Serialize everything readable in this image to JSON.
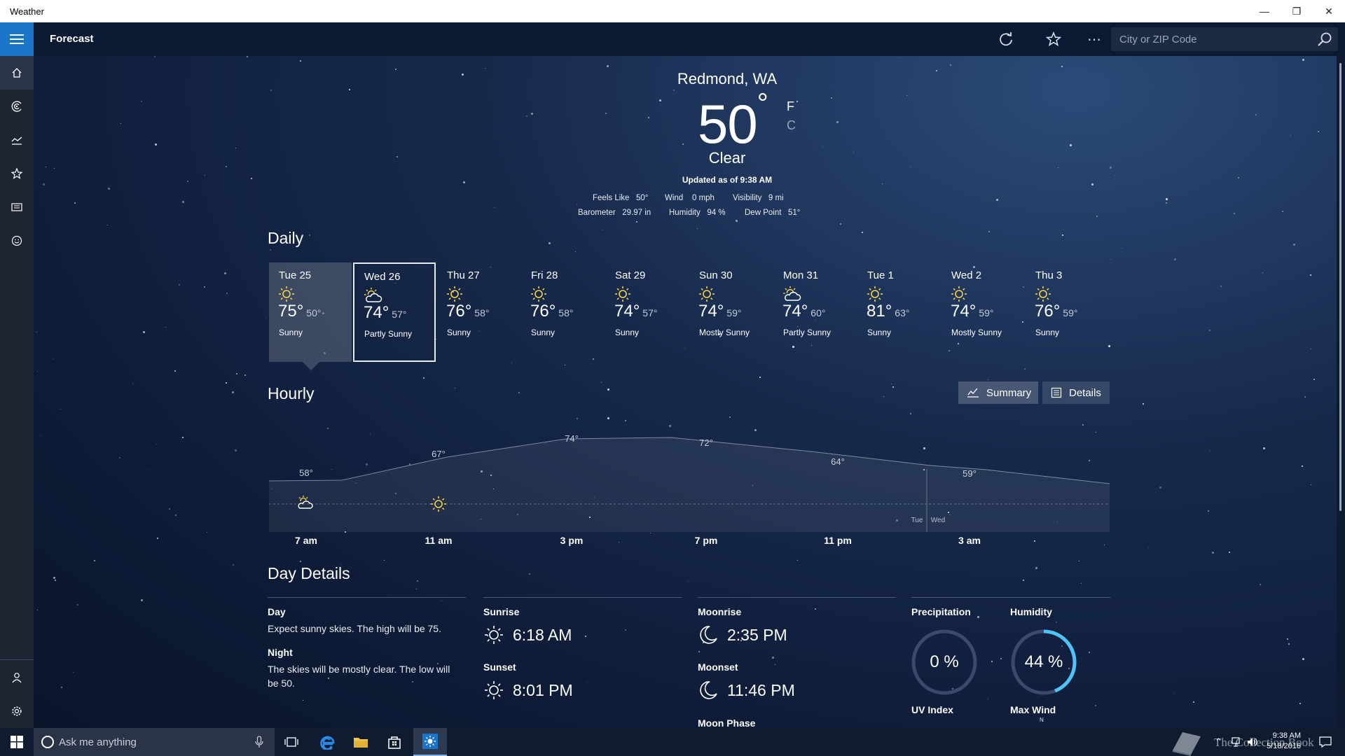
{
  "window": {
    "title": "Weather"
  },
  "header": {
    "title": "Forecast",
    "search_placeholder": "City or ZIP Code"
  },
  "current": {
    "location": "Redmond, WA",
    "temperature": "50",
    "degree": "°",
    "unit_f": "F",
    "unit_c": "C",
    "condition": "Clear",
    "updated": "Updated as of 9:38 AM",
    "observations": [
      {
        "label": "Feels Like",
        "value": "50°"
      },
      {
        "label": "Wind",
        "value": "0 mph"
      },
      {
        "label": "Visibility",
        "value": "9 mi"
      },
      {
        "label": "Barometer",
        "value": "29.97 in"
      },
      {
        "label": "Humidity",
        "value": "94 %"
      },
      {
        "label": "Dew Point",
        "value": "51°"
      }
    ]
  },
  "daily": {
    "title": "Daily",
    "days": [
      {
        "name": "Tue 25",
        "high": "75°",
        "low": "50°",
        "condition": "Sunny",
        "icon": "sun-icon"
      },
      {
        "name": "Wed 26",
        "high": "74°",
        "low": "57°",
        "condition": "Partly Sunny",
        "icon": "partly-sunny-icon"
      },
      {
        "name": "Thu 27",
        "high": "76°",
        "low": "58°",
        "condition": "Sunny",
        "icon": "sun-icon"
      },
      {
        "name": "Fri 28",
        "high": "76°",
        "low": "58°",
        "condition": "Sunny",
        "icon": "sun-icon"
      },
      {
        "name": "Sat 29",
        "high": "74°",
        "low": "57°",
        "condition": "Sunny",
        "icon": "sun-icon"
      },
      {
        "name": "Sun 30",
        "high": "74°",
        "low": "59°",
        "condition": "Mostly Sunny",
        "icon": "sun-icon"
      },
      {
        "name": "Mon 31",
        "high": "74°",
        "low": "60°",
        "condition": "Partly Sunny",
        "icon": "partly-sunny-icon"
      },
      {
        "name": "Tue 1",
        "high": "81°",
        "low": "63°",
        "condition": "Sunny",
        "icon": "sun-icon"
      },
      {
        "name": "Wed 2",
        "high": "74°",
        "low": "59°",
        "condition": "Mostly Sunny",
        "icon": "sun-icon"
      },
      {
        "name": "Thu 3",
        "high": "76°",
        "low": "59°",
        "condition": "Sunny",
        "icon": "sun-icon"
      }
    ]
  },
  "hourly": {
    "title": "Hourly",
    "summary_label": "Summary",
    "details_label": "Details",
    "temps": [
      {
        "label": "58°"
      },
      {
        "label": "67°"
      },
      {
        "label": "74°"
      },
      {
        "label": "72°"
      },
      {
        "label": "64°"
      },
      {
        "label": "59°"
      }
    ],
    "times": [
      "7 am",
      "11 am",
      "3 pm",
      "7 pm",
      "11 pm",
      "3 am"
    ],
    "day_markers": [
      "Tue",
      "Wed"
    ]
  },
  "day_details": {
    "title": "Day Details",
    "day_label": "Day",
    "day_text": "Expect sunny skies. The high will be 75.",
    "night_label": "Night",
    "night_text_1": "The skies will be mostly clear. The low will",
    "night_text_2": "be 50.",
    "sunrise_label": "Sunrise",
    "sunrise": "6:18 AM",
    "sunset_label": "Sunset",
    "sunset": "8:01 PM",
    "moonrise_label": "Moonrise",
    "moonrise": "2:35 PM",
    "moonset_label": "Moonset",
    "moonset": "11:46 PM",
    "moon_phase_label": "Moon Phase",
    "precip_label": "Precipitation",
    "precip": "0 %",
    "precip_fraction": 0,
    "humidity_label": "Humidity",
    "humidity": "44 %",
    "humidity_fraction": 0.44,
    "uv_label": "UV Index",
    "wind_label": "Max Wind",
    "wind_dir": "N"
  },
  "taskbar": {
    "cortana_placeholder": "Ask me anything",
    "time": "9:38 AM",
    "date": "5/18/2016"
  },
  "watermark": "The Collection Book",
  "colors": {
    "accent": "#1a74c9",
    "sun": "#f5d547",
    "ring": "#4fc3f7"
  }
}
